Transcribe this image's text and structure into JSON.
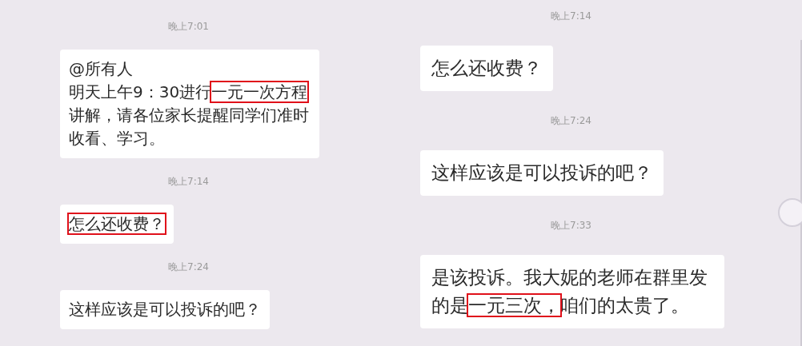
{
  "panels": [
    {
      "items": [
        {
          "kind": "time",
          "text": "晚上7:01"
        },
        {
          "kind": "message",
          "mention": "@所有人",
          "parts": [
            {
              "text": "明天上午9：30进行",
              "highlighted": false
            },
            {
              "text": "一元一次方程",
              "highlighted": true
            },
            {
              "text": "讲解，请各位家长提醒同学们准时收看、学习。",
              "highlighted": false
            }
          ]
        },
        {
          "kind": "time",
          "text": "晚上7:14"
        },
        {
          "kind": "message",
          "parts": [
            {
              "text": "怎么还收费？",
              "highlighted": true
            }
          ]
        },
        {
          "kind": "time",
          "text": "晚上7:24"
        },
        {
          "kind": "message",
          "parts": [
            {
              "text": "这样应该是可以投诉的吧？",
              "highlighted": false
            }
          ]
        }
      ]
    },
    {
      "items": [
        {
          "kind": "time",
          "text": "晚上7:14"
        },
        {
          "kind": "message",
          "parts": [
            {
              "text": "怎么还收费？",
              "highlighted": false
            }
          ]
        },
        {
          "kind": "time",
          "text": "晚上7:24"
        },
        {
          "kind": "message",
          "parts": [
            {
              "text": "这样应该是可以投诉的吧？",
              "highlighted": false
            }
          ]
        },
        {
          "kind": "time",
          "text": "晚上7:33"
        },
        {
          "kind": "message",
          "parts": [
            {
              "text": "是该投诉。我大妮的老师在群里发的是",
              "highlighted": false
            },
            {
              "text": "一元三次，",
              "highlighted": true
            },
            {
              "text": "咱们的太贵了。",
              "highlighted": false
            }
          ]
        }
      ]
    }
  ]
}
